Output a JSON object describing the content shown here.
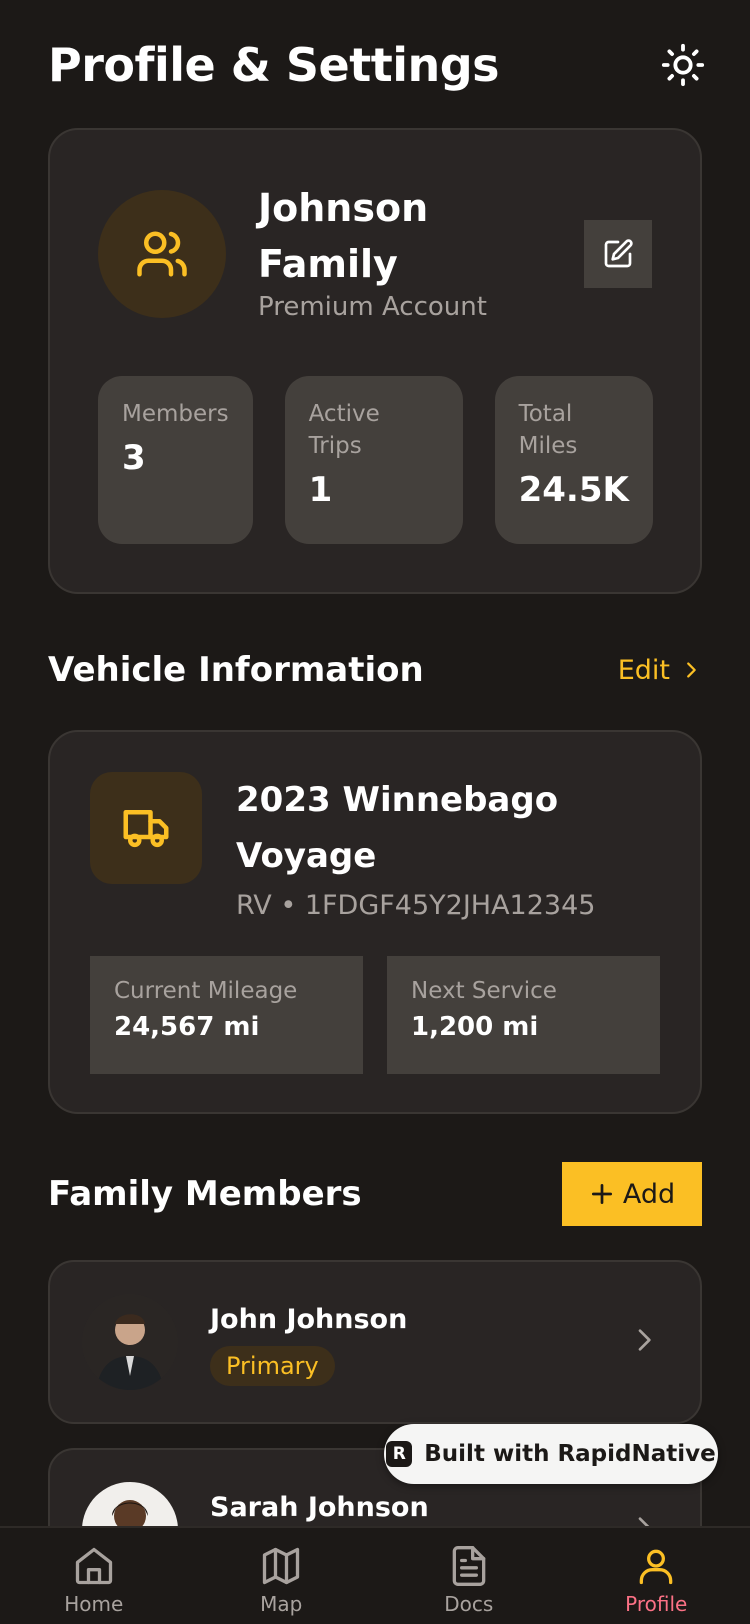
{
  "header": {
    "title": "Profile & Settings",
    "theme_icon": "sun-icon"
  },
  "profile": {
    "family_name": "Johnson Family",
    "account_type": "Premium Account",
    "avatar_icon": "users-icon",
    "edit_icon": "edit-icon",
    "stats": [
      {
        "label": "Members",
        "value": "3"
      },
      {
        "label": "Active Trips",
        "value": "1"
      },
      {
        "label": "Total Miles",
        "value": "24.5K"
      }
    ]
  },
  "vehicle_section": {
    "title": "Vehicle Information",
    "edit_label": "Edit"
  },
  "vehicle": {
    "name": "2023 Winnebago Voyage",
    "subtitle": "RV • 1FDGF45Y2JHA12345",
    "icon": "truck-icon",
    "stats": [
      {
        "label": "Current Mileage",
        "value": "24,567 mi"
      },
      {
        "label": "Next Service",
        "value": "1,200 mi"
      }
    ]
  },
  "members_section": {
    "title": "Family Members",
    "add_label": "Add"
  },
  "members": [
    {
      "name": "John Johnson",
      "badge": "Primary"
    },
    {
      "name": "Sarah Johnson"
    }
  ],
  "badge": {
    "text": "Built with RapidNative",
    "logo": "R"
  },
  "tabs": [
    {
      "label": "Home",
      "icon": "home-icon"
    },
    {
      "label": "Map",
      "icon": "map-icon"
    },
    {
      "label": "Docs",
      "icon": "docs-icon"
    },
    {
      "label": "Profile",
      "icon": "profile-icon",
      "active": true
    }
  ],
  "colors": {
    "accent": "#fbbf24",
    "background": "#1c1917",
    "card": "#292524",
    "active_tab_label": "#fb7185"
  }
}
